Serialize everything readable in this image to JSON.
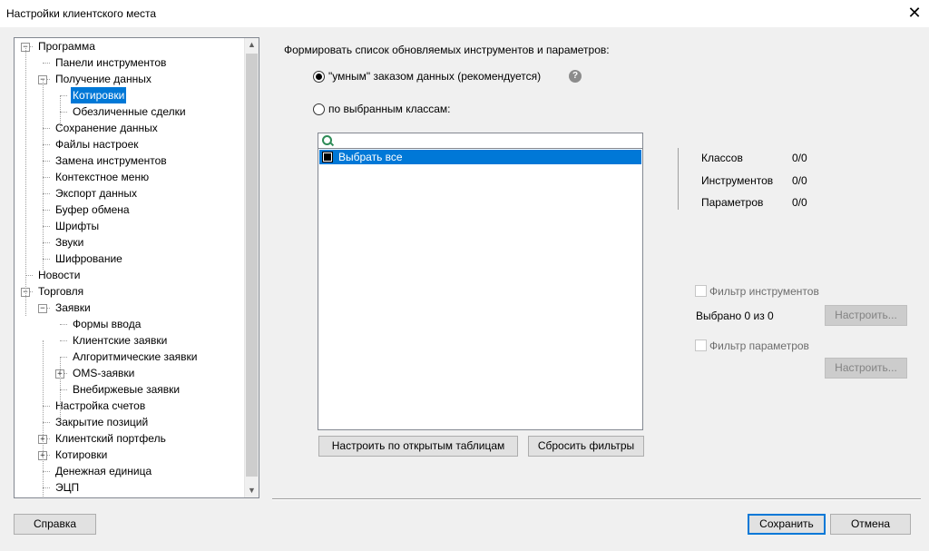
{
  "window": {
    "title": "Настройки клиентского места",
    "close_glyph": "✕"
  },
  "tree": [
    {
      "label": "Программа",
      "expander": "−"
    },
    {
      "label": "Панели инструментов"
    },
    {
      "label": "Получение данных",
      "expander": "−"
    },
    {
      "label": "Котировки",
      "selected": true
    },
    {
      "label": "Обезличенные сделки"
    },
    {
      "label": "Сохранение данных"
    },
    {
      "label": "Файлы настроек"
    },
    {
      "label": "Замена инструментов"
    },
    {
      "label": "Контекстное меню"
    },
    {
      "label": "Экспорт данных"
    },
    {
      "label": "Буфер обмена"
    },
    {
      "label": "Шрифты"
    },
    {
      "label": "Звуки"
    },
    {
      "label": "Шифрование"
    },
    {
      "label": "Новости"
    },
    {
      "label": "Торговля",
      "expander": "−"
    },
    {
      "label": "Заявки",
      "expander": "−"
    },
    {
      "label": "Формы ввода"
    },
    {
      "label": "Клиентские заявки"
    },
    {
      "label": "Алгоритмические заявки"
    },
    {
      "label": "OMS-заявки",
      "expander": "+"
    },
    {
      "label": "Внебиржевые заявки"
    },
    {
      "label": "Настройка счетов"
    },
    {
      "label": "Закрытие позиций"
    },
    {
      "label": "Клиентский портфель",
      "expander": "+"
    },
    {
      "label": "Котировки",
      "expander": "+"
    },
    {
      "label": "Денежная единица"
    },
    {
      "label": "ЭЦП"
    }
  ],
  "main": {
    "heading": "Формировать список обновляемых инструментов и параметров:",
    "radio_smart": "\"умным\" заказом данных (рекомендуется)",
    "radio_classes": "по выбранным классам:",
    "help_glyph": "?",
    "select_all": "Выбрать все",
    "btn_open_tables": "Настроить по открытым таблицам",
    "btn_reset_filters": "Сбросить фильтры",
    "stats": [
      {
        "label": "Классов",
        "value": "0/0"
      },
      {
        "label": "Инструментов",
        "value": "0/0"
      },
      {
        "label": "Параметров",
        "value": "0/0"
      }
    ],
    "filter_instruments": "Фильтр инструментов",
    "selected_count": "Выбрано 0 из 0",
    "btn_configure": "Настроить...",
    "filter_params": "Фильтр параметров"
  },
  "footer": {
    "help": "Справка",
    "save": "Сохранить",
    "cancel": "Отмена"
  }
}
